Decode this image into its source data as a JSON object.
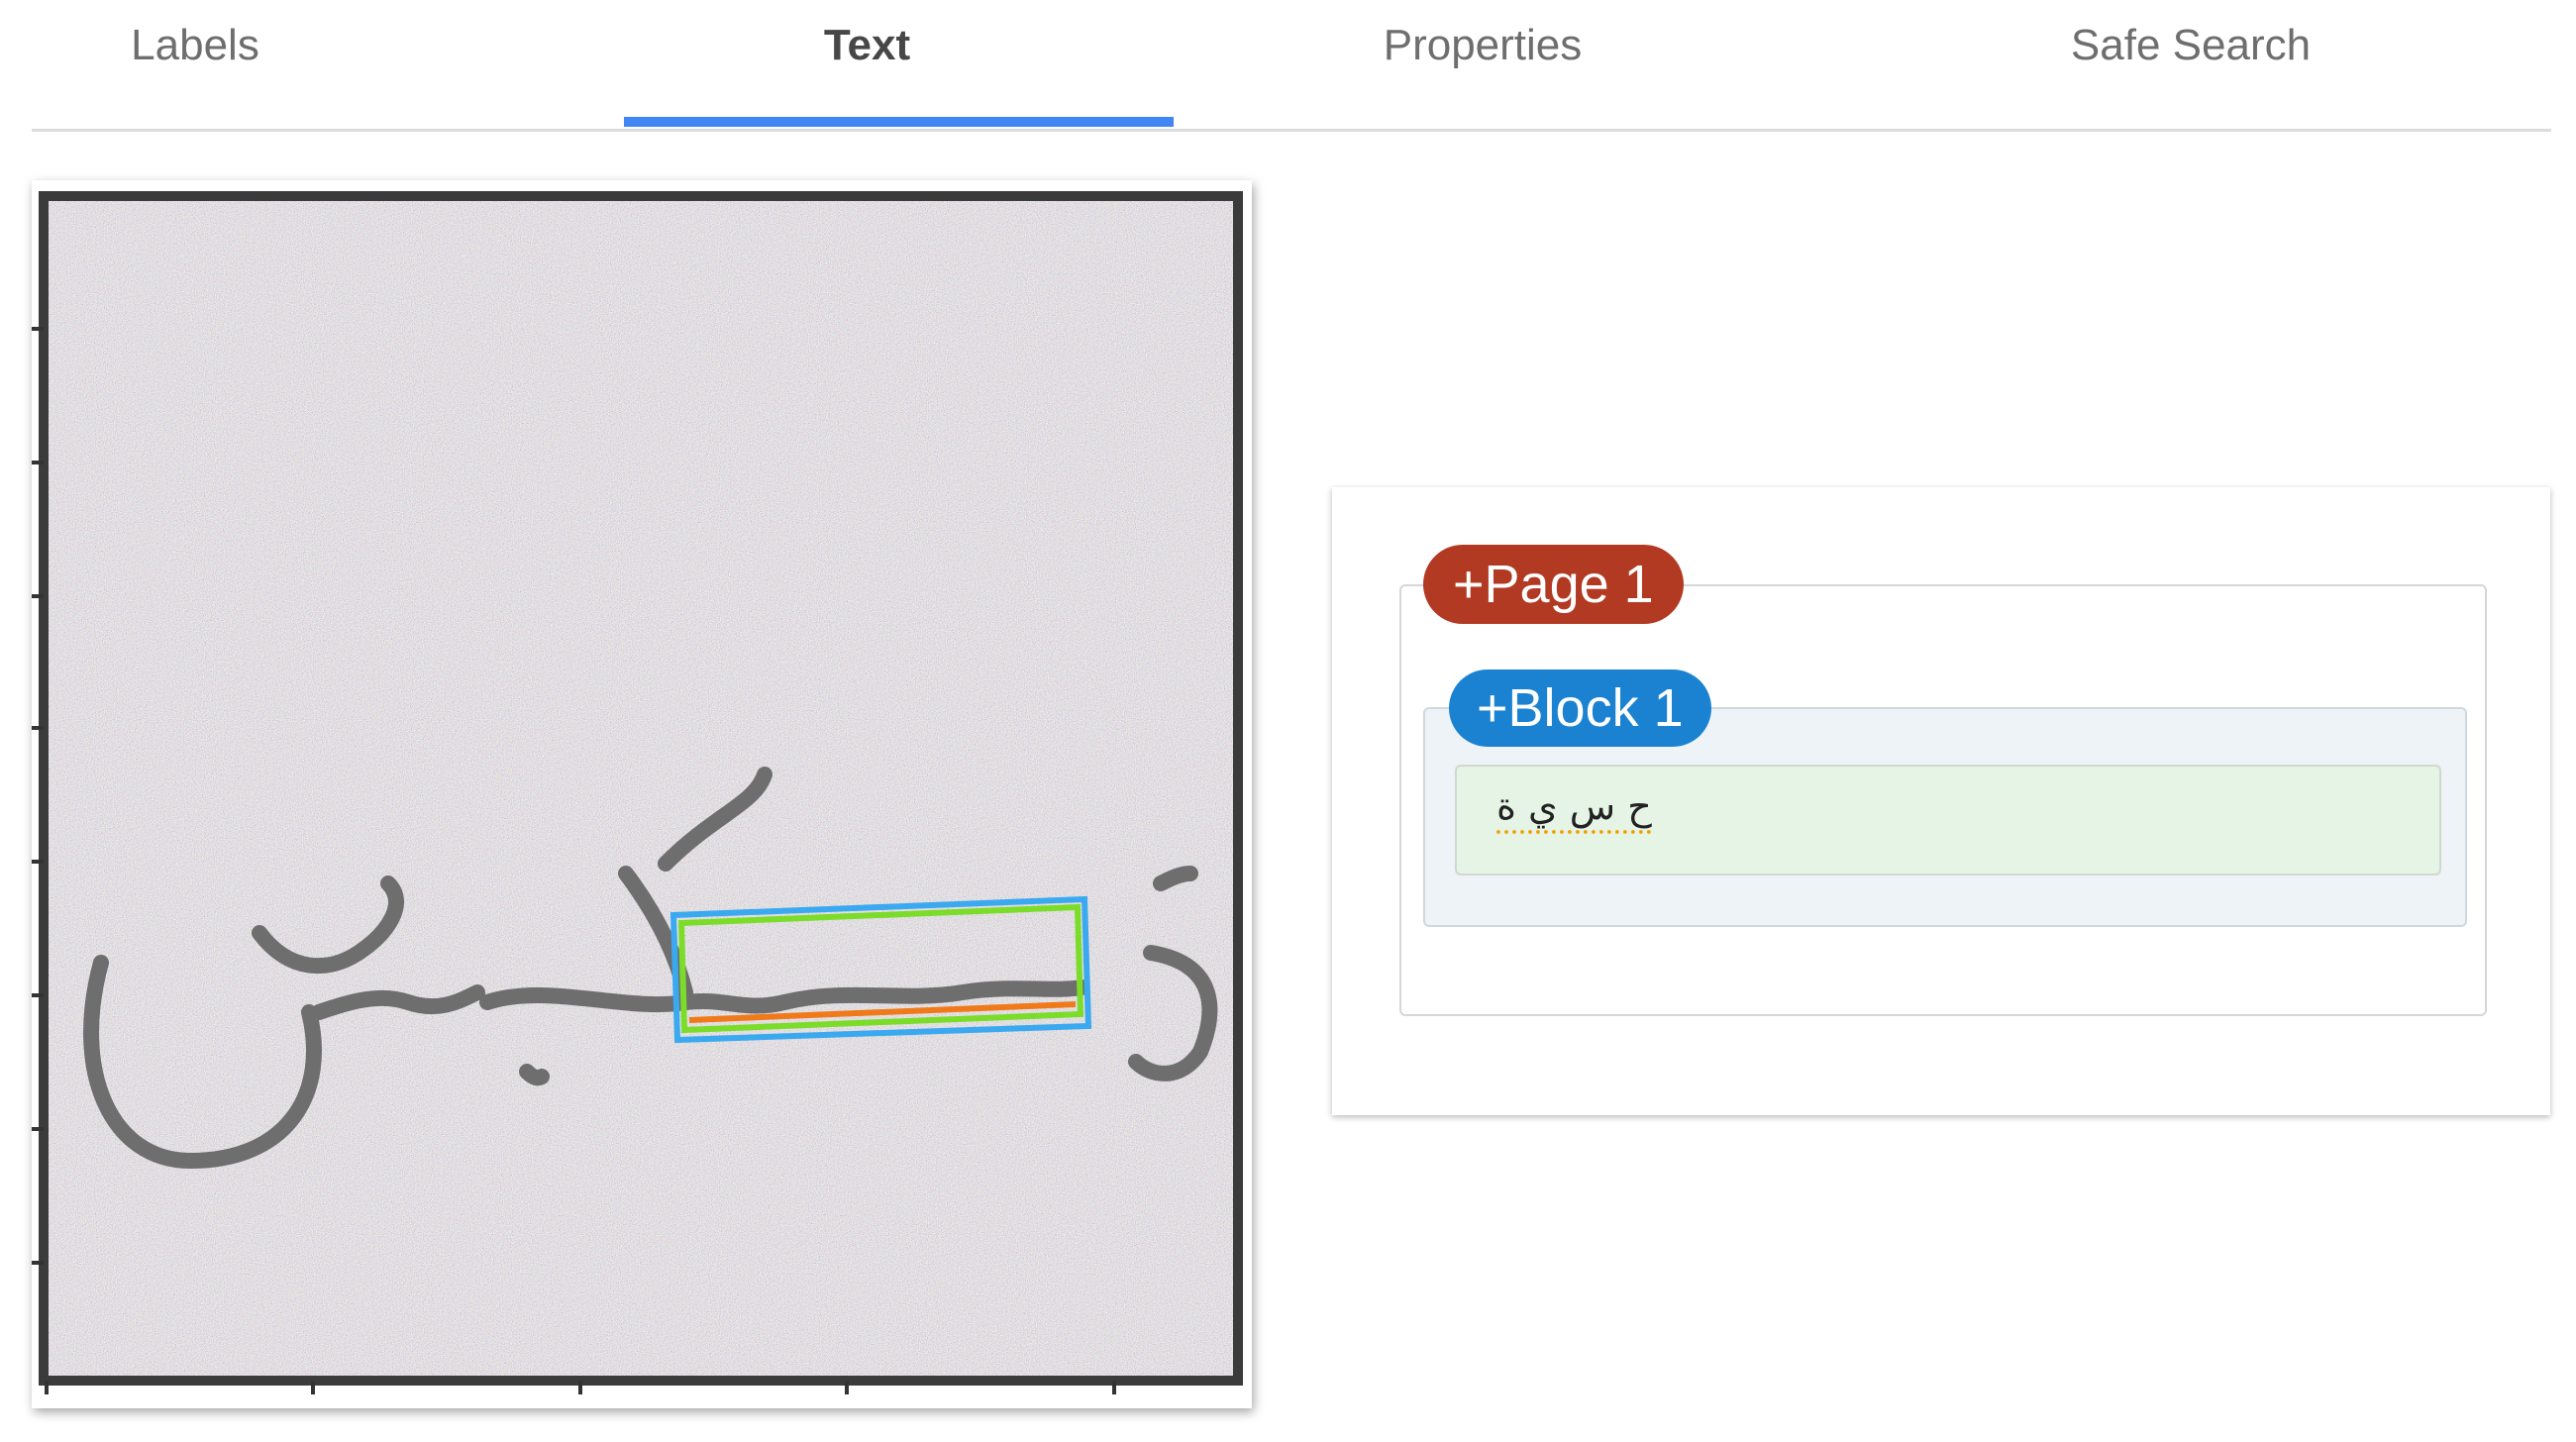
{
  "tabs": [
    {
      "label": "Labels",
      "active": false
    },
    {
      "label": "Text",
      "active": true
    },
    {
      "label": "Properties",
      "active": false
    },
    {
      "label": "Safe Search",
      "active": false
    }
  ],
  "colors": {
    "tab_indicator": "#4285f4",
    "page_chip": "#b23a22",
    "block_chip": "#1a82d0",
    "block_bg": "#eef3f7",
    "paragraph_bg": "#e6f4e6",
    "bounding_box_outer": "#3aa9f0",
    "bounding_box_middle": "#7bdc2a",
    "bounding_box_inner": "#f07a1a"
  },
  "preview": {
    "image_kind": "handwritten Arabic word on color-noise background with detected text bounding box"
  },
  "result": {
    "page_label": "+Page 1",
    "block_label": "+Block 1",
    "paragraph_text": "ح س ي ة"
  }
}
